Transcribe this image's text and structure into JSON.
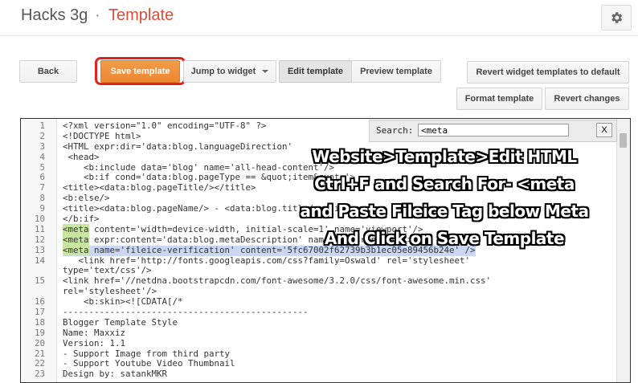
{
  "header": {
    "blog_name": "Hacks 3g",
    "separator": "·",
    "page_title": "Template",
    "settings_icon": "gear-icon"
  },
  "toolbar": {
    "back_label": "Back",
    "save_template_label": "Save template",
    "jump_to_widget_label": "Jump to widget",
    "edit_template_label": "Edit template",
    "preview_template_label": "Preview template",
    "revert_widget_label": "Revert widget templates to default",
    "format_template_label": "Format template",
    "revert_changes_label": "Revert changes"
  },
  "search": {
    "label": "Search:",
    "value": "<meta",
    "close_label": "X"
  },
  "colors": {
    "accent_orange": "#ee8734",
    "title_red": "#dd4b39",
    "highlight_ring": "#e0221f",
    "match_highlight": "#c8e6a0",
    "selection": "#c9d7f2"
  },
  "code_lines": [
    {
      "num": "1",
      "text": "<?xml version=\"1.0\" encoding=\"UTF-8\" ?>"
    },
    {
      "num": "2",
      "text": "<!DOCTYPE html>"
    },
    {
      "num": "3",
      "text": "<HTML expr:dir='data:blog.languageDirection'"
    },
    {
      "num": "4",
      "text": " <head>"
    },
    {
      "num": "5",
      "text": "    <b:include data='blog' name='all-head-content'/>"
    },
    {
      "num": "6",
      "text": "    <b:if cond='data:blog.pageType == &quot;item&quot;'>"
    },
    {
      "num": "7",
      "text": "<title><data:blog.pageTitle/></title>"
    },
    {
      "num": "8",
      "text": "<b:else/>"
    },
    {
      "num": "9",
      "text": "<title><data:blog.pageName/> - <data:blog.title/></title>"
    },
    {
      "num": "10",
      "text": "</b:if>"
    },
    {
      "num": "11",
      "match": "<meta",
      "text": " content='width=device-width, initial-scale=1' name='viewport'/>"
    },
    {
      "num": "12",
      "match": "<meta",
      "text": " expr:content='data:blog.metaDescription' name='description'/>"
    },
    {
      "num": "13",
      "match": "<meta",
      "text": " name='fileice-verification' content='5fc67002f62739b3b1ec05e89456b24e' />"
    },
    {
      "num": "14",
      "text": "   <link href='http://fonts.googleapis.com/css?family=Oswald' rel='stylesheet'"
    },
    {
      "num": "",
      "text": "type='text/css'/>"
    },
    {
      "num": "15",
      "text": "<link href='//netdna.bootstrapcdn.com/font-awesome/3.2.0/css/font-awesome.min.css'"
    },
    {
      "num": "",
      "text": "rel='stylesheet'/>"
    },
    {
      "num": "16",
      "text": "    <b:skin><![CDATA[/*"
    },
    {
      "num": "17",
      "text": "-----------------------------------------------"
    },
    {
      "num": "18",
      "text": "Blogger Template Style"
    },
    {
      "num": "19",
      "text": "Name: Maxxiz"
    },
    {
      "num": "20",
      "text": "Version: 1.1"
    },
    {
      "num": "21",
      "text": "- Support Image from third party"
    },
    {
      "num": "22",
      "text": "- Support Youtube Video Thumbnail"
    },
    {
      "num": "23",
      "text": "Design by: satankMKR"
    }
  ],
  "overlay_lines": [
    "Website>Template>Edit HTML",
    "Ctrl+F and Search For- <meta",
    "and Paste Fileice Tag below Meta",
    "And Click on Save Template"
  ]
}
